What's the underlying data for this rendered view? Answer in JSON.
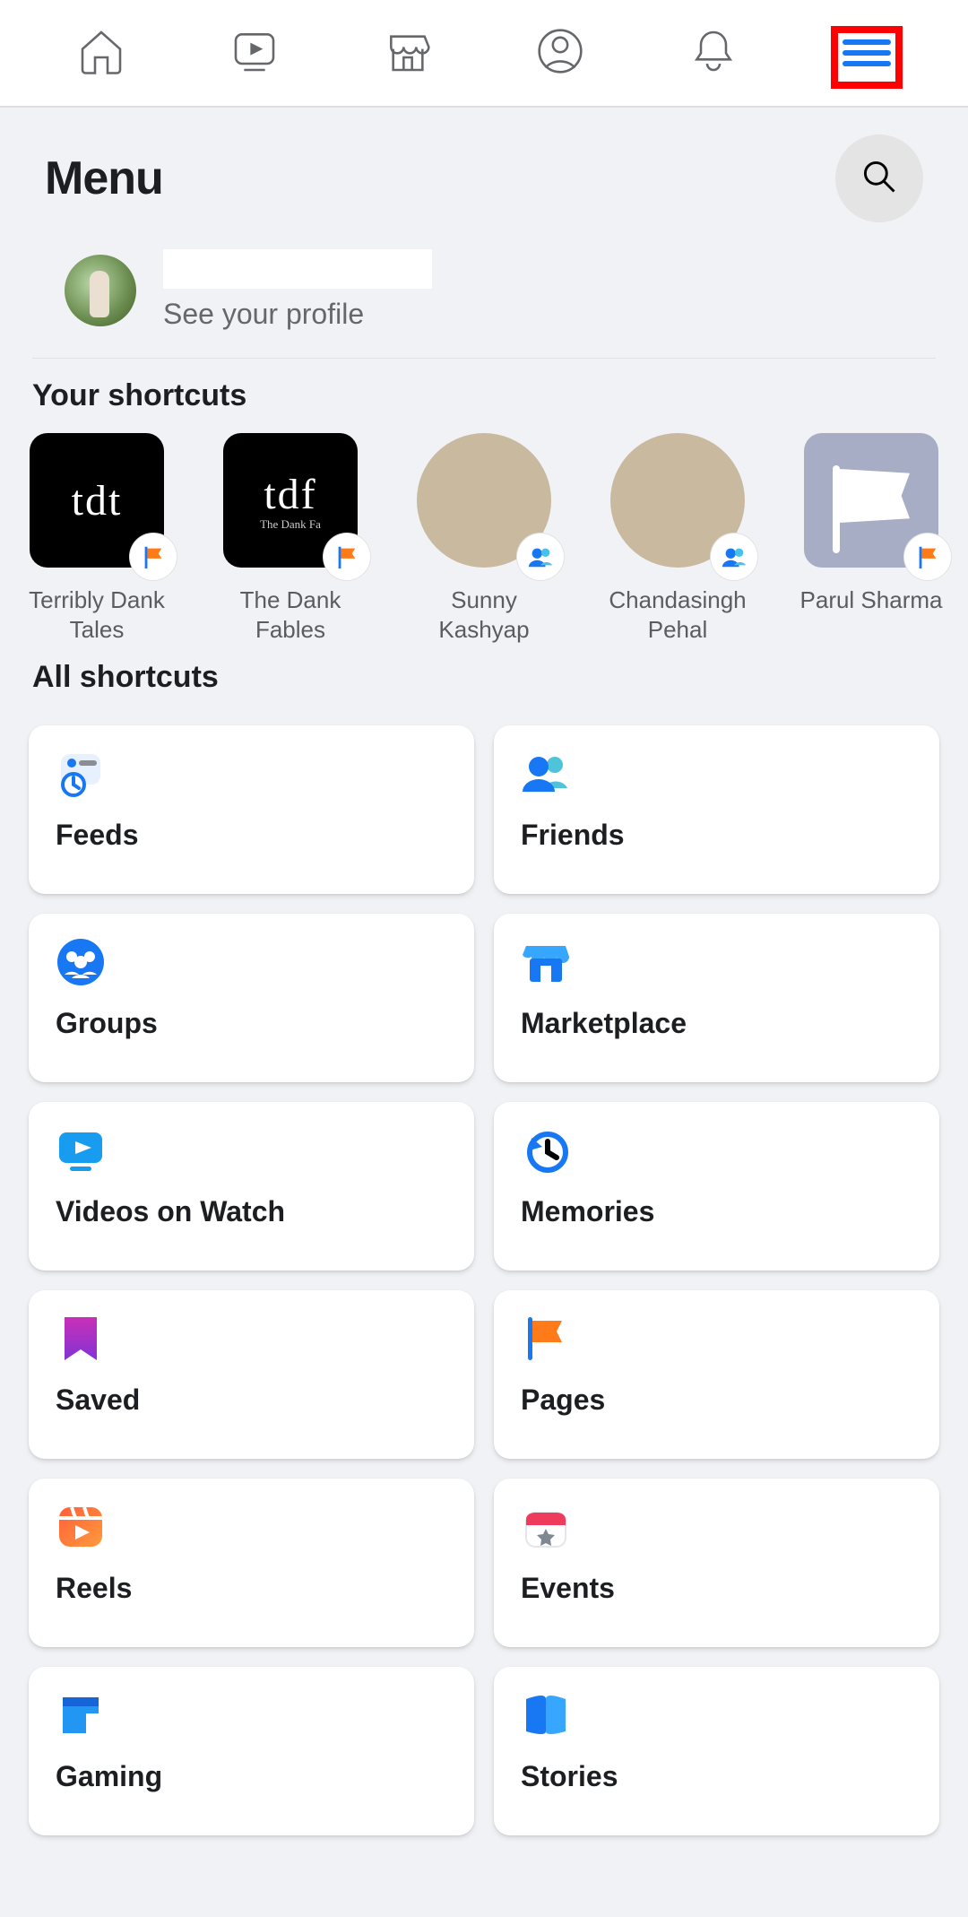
{
  "nav": {
    "items": [
      "home",
      "watch",
      "marketplace",
      "profile",
      "notifications",
      "menu"
    ],
    "active": "menu"
  },
  "header": {
    "title": "Menu"
  },
  "profile": {
    "name": "",
    "subtitle": "See your profile"
  },
  "shortcuts": {
    "title": "Your shortcuts",
    "items": [
      {
        "label": "Terribly Dank Tales",
        "thumb_text": "tdt",
        "badge": "page-flag"
      },
      {
        "label": "The Dank Fables",
        "thumb_text": "tdf",
        "thumb_sub": "The Dank Fa",
        "badge": "page-flag"
      },
      {
        "label": "Sunny Kashyap",
        "thumb_text": "",
        "badge": "group-people",
        "kind": "person"
      },
      {
        "label": "Chandasingh Pehal",
        "thumb_text": "",
        "badge": "group-people",
        "kind": "person"
      },
      {
        "label": "Parul Sharma",
        "thumb_text": "",
        "badge": "page-flag",
        "kind": "flag"
      }
    ]
  },
  "all_shortcuts": {
    "title": "All shortcuts",
    "cards": [
      {
        "icon": "feeds",
        "label": "Feeds"
      },
      {
        "icon": "friends",
        "label": "Friends"
      },
      {
        "icon": "groups",
        "label": "Groups"
      },
      {
        "icon": "marketplace",
        "label": "Marketplace"
      },
      {
        "icon": "videos",
        "label": "Videos on Watch"
      },
      {
        "icon": "memories",
        "label": "Memories"
      },
      {
        "icon": "saved",
        "label": "Saved"
      },
      {
        "icon": "pages",
        "label": "Pages"
      },
      {
        "icon": "reels",
        "label": "Reels"
      },
      {
        "icon": "events",
        "label": "Events"
      },
      {
        "icon": "gaming",
        "label": "Gaming"
      },
      {
        "icon": "stories",
        "label": "Stories"
      }
    ]
  }
}
